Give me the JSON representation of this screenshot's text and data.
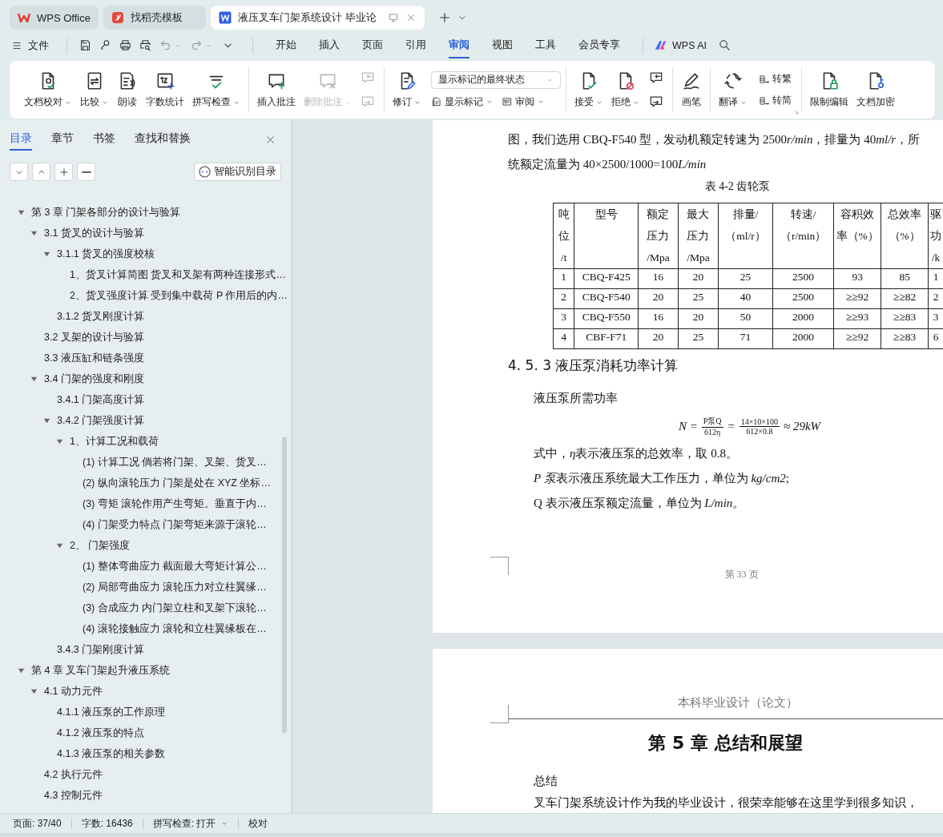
{
  "browser_tabs": [
    {
      "title": "WPS Office",
      "kind": "home",
      "selected": false
    },
    {
      "title": "找稻壳模板",
      "kind": "template",
      "selected": false
    },
    {
      "title": "液压叉车门架系统设计 毕业论",
      "kind": "document",
      "selected": true
    }
  ],
  "menu_bar": {
    "file": "文件",
    "tabs": [
      {
        "label": "开始",
        "selected": false
      },
      {
        "label": "插入",
        "selected": false
      },
      {
        "label": "页面",
        "selected": false
      },
      {
        "label": "引用",
        "selected": false
      },
      {
        "label": "审阅",
        "selected": true
      },
      {
        "label": "视图",
        "selected": false
      },
      {
        "label": "工具",
        "selected": false
      },
      {
        "label": "会员专享",
        "selected": false
      }
    ],
    "ai": "WPS AI"
  },
  "ribbon": {
    "groups": [
      {
        "items": [
          {
            "kind": "large",
            "label": "文档校对",
            "dropdown": true,
            "disabled": false
          },
          {
            "kind": "large",
            "label": "比较",
            "dropdown": true,
            "disabled": false
          },
          {
            "kind": "large",
            "label": "朗读",
            "dropdown": false,
            "disabled": false
          },
          {
            "kind": "large",
            "label": "字数统计",
            "dropdown": false,
            "disabled": false
          },
          {
            "kind": "large",
            "label": "拼写检查",
            "dropdown": true,
            "disabled": false
          }
        ]
      },
      {
        "items": [
          {
            "kind": "large",
            "label": "插入批注",
            "dropdown": false,
            "disabled": false
          },
          {
            "kind": "large",
            "label": "删除批注",
            "dropdown": true,
            "disabled": true
          },
          {
            "kind": "icon-stack",
            "buttons": [
              {
                "disabled": true
              },
              {
                "disabled": true
              }
            ]
          }
        ]
      },
      {
        "items": [
          {
            "kind": "large",
            "label": "修订",
            "dropdown": true,
            "disabled": false
          },
          {
            "kind": "display-panel",
            "select": "显示标记的最终状态",
            "buttons": [
              {
                "label": "显示标记",
                "dropdown": true
              },
              {
                "label": "审阅",
                "dropdown": true
              }
            ]
          }
        ]
      },
      {
        "items": [
          {
            "kind": "large",
            "label": "接受",
            "dropdown": true,
            "disabled": false
          },
          {
            "kind": "large",
            "label": "拒绝",
            "dropdown": true,
            "disabled": false
          },
          {
            "kind": "icon-stack",
            "buttons": [
              {
                "disabled": false
              },
              {
                "disabled": false
              }
            ]
          }
        ]
      },
      {
        "items": [
          {
            "kind": "large",
            "label": "画笔",
            "dropdown": false,
            "disabled": false
          }
        ]
      },
      {
        "items": [
          {
            "kind": "large",
            "label": "翻译",
            "dropdown": true,
            "disabled": false
          },
          {
            "kind": "small-stack",
            "buttons": [
              {
                "label": "转繁"
              },
              {
                "label": "转简"
              }
            ]
          }
        ]
      },
      {
        "items": [
          {
            "kind": "large",
            "label": "限制编辑",
            "dropdown": false,
            "disabled": false
          },
          {
            "kind": "large",
            "label": "文档加密",
            "dropdown": false,
            "disabled": false
          }
        ]
      }
    ]
  },
  "navigation": {
    "tabs": [
      {
        "label": "目录",
        "selected": true
      },
      {
        "label": "章节",
        "selected": false
      },
      {
        "label": "书签",
        "selected": false
      },
      {
        "label": "查找和替换",
        "selected": false
      }
    ],
    "smart_button": "智能识别目录",
    "toc": [
      {
        "text": "第 3 章 门架各部分的设计与验算",
        "expanded": true,
        "children": [
          {
            "text": "3.1 货叉的设计与验算",
            "expanded": true,
            "children": [
              {
                "text": "3.1.1 货叉的强度校核",
                "expanded": true,
                "children": [
                  {
                    "text": "1、货叉计算简图 货叉和叉架有两种连接形式…"
                  },
                  {
                    "text": "2、货叉强度计算 受到集中载荷 P 作用后的内…"
                  }
                ]
              },
              {
                "text": "3.1.2 货叉刚度计算"
              }
            ]
          },
          {
            "text": "3.2 叉架的设计与验算"
          },
          {
            "text": "3.3 液压缸和链条强度"
          },
          {
            "text": "3.4 门架的强度和刚度",
            "expanded": true,
            "children": [
              {
                "text": "3.4.1 门架高度计算"
              },
              {
                "text": "3.4.2 门架强度计算",
                "expanded": true,
                "children": [
                  {
                    "text": "1、计算工况和载荷",
                    "expanded": true,
                    "children": [
                      {
                        "text": "(1) 计算工况 倘若将门架、叉架、货叉…"
                      },
                      {
                        "text": "(2) 纵向滚轮压力 门架是处在 XYZ 坐标…"
                      },
                      {
                        "text": "(3) 弯矩 滚轮作用产生弯矩。垂直于内…"
                      },
                      {
                        "text": "(4) 门架受力特点 门架弯矩来源于滚轮…"
                      }
                    ]
                  },
                  {
                    "text": "2、 门架强度",
                    "expanded": true,
                    "children": [
                      {
                        "text": "(1) 整体弯曲应力 截面最大弯矩计算公…"
                      },
                      {
                        "text": "(2) 局部弯曲应力 滚轮压力对立柱翼缘…"
                      },
                      {
                        "text": "(3) 合成应力 内门架立柱和叉架下滚轮…"
                      },
                      {
                        "text": "(4) 滚轮接触应力 滚轮和立柱翼缘板在…"
                      }
                    ]
                  }
                ]
              },
              {
                "text": "3.4.3 门架刚度计算"
              }
            ]
          }
        ]
      },
      {
        "text": "第 4 章 叉车门架起升液压系统",
        "expanded": true,
        "children": [
          {
            "text": "4.1 动力元件",
            "expanded": true,
            "children": [
              {
                "text": "4.1.1 液压泵的工作原理"
              },
              {
                "text": "4.1.2 液压泵的特点"
              },
              {
                "text": "4.1.3 液压泵的相关参数"
              }
            ]
          },
          {
            "text": "4.2 执行元件"
          },
          {
            "text": "4.3 控制元件"
          }
        ]
      }
    ]
  },
  "document": {
    "page_1": {
      "lines": [
        [
          {
            "text": "图，我们选用 CBQ-F540 型，发动机额定转速为 2500"
          },
          {
            "text": "r/min",
            "italic": true
          },
          {
            "text": "，排量为 40"
          },
          {
            "text": "ml/r",
            "italic": true
          },
          {
            "text": "，所"
          }
        ],
        [
          {
            "text": "统额定流量为 40×2500/1000=100"
          },
          {
            "text": "L/min",
            "italic": true
          }
        ]
      ],
      "table_caption": "表 4-2 齿轮泵",
      "table": {
        "columns": [
          {
            "lines": [
              "吨",
              "位",
              "/t"
            ]
          },
          {
            "lines": [
              "型号"
            ]
          },
          {
            "lines": [
              "额定",
              "压力",
              "/Mpa"
            ]
          },
          {
            "lines": [
              "最大",
              "压力",
              "/Mpa"
            ]
          },
          {
            "lines": [
              "排量/",
              "（ml/r）"
            ]
          },
          {
            "lines": [
              "转速/",
              "（r/min）"
            ]
          },
          {
            "lines": [
              "容积效",
              "率（%）"
            ]
          },
          {
            "lines": [
              "总效率",
              "（%）"
            ]
          },
          {
            "lines": [
              "驱",
              "功",
              "/k"
            ]
          }
        ],
        "rows": [
          [
            "1",
            "CBQ-F425",
            "16",
            "20",
            "25",
            "2500",
            "93",
            "85",
            "1"
          ],
          [
            "2",
            "CBQ-F540",
            "20",
            "25",
            "40",
            "2500",
            "≥≥92",
            "≥≥82",
            "2"
          ],
          [
            "3",
            "CBQ-F550",
            "16",
            "20",
            "50",
            "2000",
            "≥≥93",
            "≥≥83",
            "3"
          ],
          [
            "4",
            "CBF-F71",
            "20",
            "25",
            "71",
            "2000",
            "≥≥92",
            "≥≥83",
            "6"
          ]
        ]
      },
      "heading": "4. 5. 3 液压泵消耗功率计算",
      "intro": "液压泵所需功率",
      "formula": [
        {
          "kind": "text",
          "text": "N ="
        },
        {
          "kind": "fraction",
          "numerator": "P泵Q",
          "denominator": "612η"
        },
        {
          "kind": "text",
          "text": "="
        },
        {
          "kind": "fraction",
          "numerator": "14×10×100",
          "denominator": "612×0.8"
        },
        {
          "kind": "text",
          "text": "≈ 29kW"
        }
      ],
      "notes": [
        [
          {
            "text": "式中，"
          },
          {
            "text": "η",
            "italic": true
          },
          {
            "text": "表示液压泵的总效率，取 0.8。"
          }
        ],
        [
          {
            "text": "P 泵",
            "italic": true
          },
          {
            "text": "表示液压系统最大工作压力，单位为 "
          },
          {
            "text": "kg/cm2",
            "italic": true
          },
          {
            "text": ";"
          }
        ],
        [
          {
            "text": "Q 表示液压泵额定流量，单位为 "
          },
          {
            "text": "L/min",
            "italic": true
          },
          {
            "text": "。"
          }
        ]
      ],
      "footer": "第 33 页"
    },
    "page_2": {
      "header": "本科毕业设计（论文）",
      "title": "第 5 章 总结和展望",
      "subtitle": "总结",
      "paragraph": "叉车门架系统设计作为我的毕业设计，很荣幸能够在这里学到很多知识，"
    }
  },
  "status_bar": {
    "items": [
      {
        "text": "页面: 37/40",
        "dropdown": false
      },
      {
        "text": "字数: 16436",
        "dropdown": false
      },
      {
        "text": "拼写检查: 打开",
        "dropdown": true
      },
      {
        "text": "校对",
        "dropdown": false
      }
    ]
  }
}
